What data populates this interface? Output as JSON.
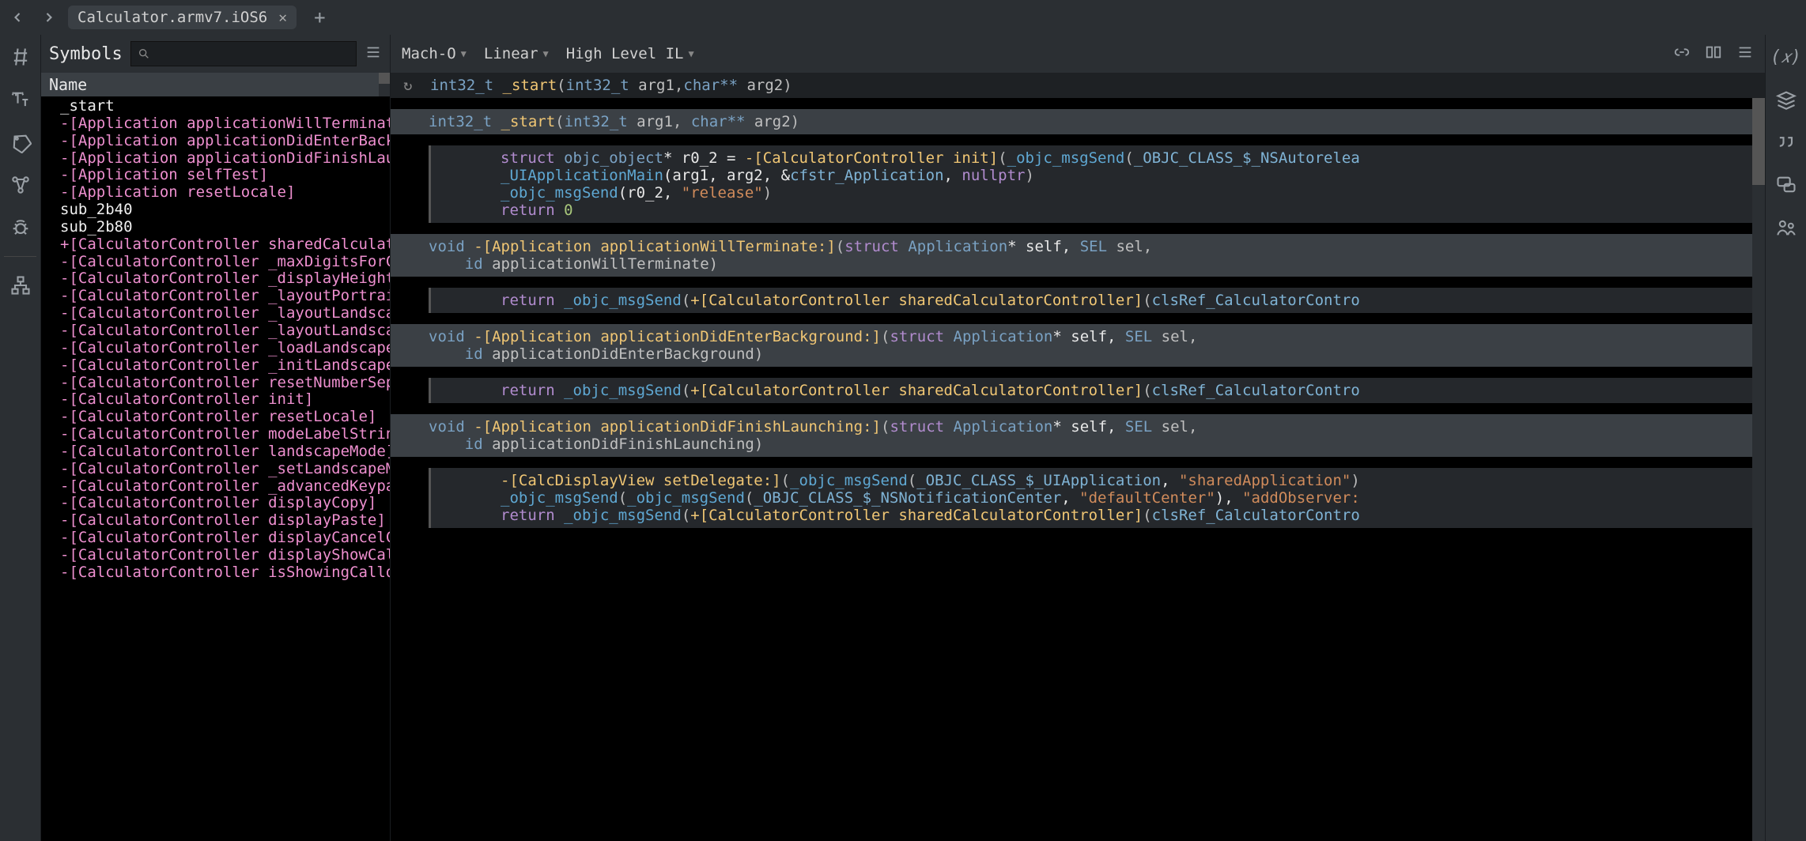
{
  "titlebar": {
    "tab_label": "Calculator.armv7.iOS6"
  },
  "sidebar": {
    "title": "Symbols",
    "column_header": "Name",
    "items": [
      {
        "text": "_start",
        "cls": "sym-white"
      },
      {
        "text": "-[Application applicationWillTerminate:]",
        "cls": "sym-pink"
      },
      {
        "text": "-[Application applicationDidEnterBackgrou",
        "cls": "sym-pink"
      },
      {
        "text": "-[Application applicationDidFinishLaunchi",
        "cls": "sym-pink"
      },
      {
        "text": "-[Application selfTest]",
        "cls": "sym-pink"
      },
      {
        "text": "-[Application resetLocale]",
        "cls": "sym-pink"
      },
      {
        "text": "sub_2b40",
        "cls": "sym-white"
      },
      {
        "text": "sub_2b80",
        "cls": "sym-white"
      },
      {
        "text": "+[CalculatorController sharedCalculatorCo",
        "cls": "sym-pink"
      },
      {
        "text": "-[CalculatorController _maxDigitsForCurre",
        "cls": "sym-pink"
      },
      {
        "text": "-[CalculatorController _displayHeightForC",
        "cls": "sym-pink"
      },
      {
        "text": "-[CalculatorController _layoutPortraitSub",
        "cls": "sym-pink"
      },
      {
        "text": "-[CalculatorController _layoutLandscapeSu",
        "cls": "sym-pink"
      },
      {
        "text": "-[CalculatorController _layoutLandscapeFo",
        "cls": "sym-pink"
      },
      {
        "text": "-[CalculatorController _loadLandscapeImag",
        "cls": "sym-pink"
      },
      {
        "text": "-[CalculatorController _initLandscape]",
        "cls": "sym-pink"
      },
      {
        "text": "-[CalculatorController resetNumberSeparat",
        "cls": "sym-pink"
      },
      {
        "text": "-[CalculatorController init]",
        "cls": "sym-pink"
      },
      {
        "text": "-[CalculatorController resetLocale]",
        "cls": "sym-pink"
      },
      {
        "text": "-[CalculatorController modeLabelString]",
        "cls": "sym-pink"
      },
      {
        "text": "-[CalculatorController landscapeMode]",
        "cls": "sym-pink"
      },
      {
        "text": "-[CalculatorController _setLandscapeMode:",
        "cls": "sym-pink"
      },
      {
        "text": "-[CalculatorController _advancedKeypadVie",
        "cls": "sym-pink"
      },
      {
        "text": "-[CalculatorController displayCopy]",
        "cls": "sym-pink"
      },
      {
        "text": "-[CalculatorController displayPaste]",
        "cls": "sym-pink"
      },
      {
        "text": "-[CalculatorController displayCancelCallo",
        "cls": "sym-pink"
      },
      {
        "text": "-[CalculatorController displayShowCallout",
        "cls": "sym-pink"
      },
      {
        "text": "-[CalculatorController isShowingCalloutBa",
        "cls": "sym-pink"
      }
    ]
  },
  "viewbar": {
    "format": "Mach-O",
    "mode": "Linear",
    "il": "High Level IL"
  },
  "signature": {
    "ret": "int32_t",
    "name": "_start",
    "p1t": "int32_t",
    "p1n": "arg1",
    "p2t": "char**",
    "p2n": "arg2"
  },
  "fn1": {
    "hdr_ret": "int32_t",
    "hdr_name": "_start",
    "hdr_p1t": "int32_t",
    "hdr_p1": "arg1",
    "hdr_p2t": "char**",
    "hdr_p2": "arg2",
    "l1a": "struct",
    "l1b": "objc_object",
    "l1c": "* r0_2 = ",
    "l1d": "-[CalculatorController init]",
    "l1e": "(",
    "l1f": "_objc_msgSend",
    "l1g": "(",
    "l1h": "_OBJC_CLASS_$_NSAutorelea",
    "l2a": "_UIApplicationMain",
    "l2b": "(arg1, arg2, &",
    "l2c": "cfstr_Application",
    "l2d": ", ",
    "l2e": "nullptr",
    "l2f": ")",
    "l3a": "_objc_msgSend",
    "l3b": "(r0_2, ",
    "l3c": "\"release\"",
    "l3d": ")",
    "l4a": "return",
    "l4b": "0"
  },
  "fn2": {
    "hdr_ret": "void",
    "hdr_name": "-[Application applicationWillTerminate:]",
    "hdr_p1t": "struct",
    "hdr_p1t2": "Application",
    "hdr_p1": "* self, ",
    "hdr_p2t": "SEL",
    "hdr_p2": "sel,",
    "hdr2_t": "id",
    "hdr2_n": "applicationWillTerminate)",
    "b1a": "return",
    "b1b": "_objc_msgSend",
    "b1c": "(",
    "b1d": "+[CalculatorController sharedCalculatorController]",
    "b1e": "(",
    "b1f": "clsRef_CalculatorContro"
  },
  "fn3": {
    "hdr_ret": "void",
    "hdr_name": "-[Application applicationDidEnterBackground:]",
    "hdr_p1t": "struct",
    "hdr_p1t2": "Application",
    "hdr_p1": "* self, ",
    "hdr_p2t": "SEL",
    "hdr_p2": "sel,",
    "hdr2_t": "id",
    "hdr2_n": "applicationDidEnterBackground)",
    "b1a": "return",
    "b1b": "_objc_msgSend",
    "b1c": "(",
    "b1d": "+[CalculatorController sharedCalculatorController]",
    "b1e": "(",
    "b1f": "clsRef_CalculatorContro"
  },
  "fn4": {
    "hdr_ret": "void",
    "hdr_name": "-[Application applicationDidFinishLaunching:]",
    "hdr_p1t": "struct",
    "hdr_p1t2": "Application",
    "hdr_p1": "* self, ",
    "hdr_p2t": "SEL",
    "hdr_p2": "sel,",
    "hdr2_t": "id",
    "hdr2_n": "applicationDidFinishLaunching)",
    "b1a": "-[CalcDisplayView setDelegate:]",
    "b1b": "(",
    "b1c": "_objc_msgSend",
    "b1d": "(",
    "b1e": "_OBJC_CLASS_$_UIApplication",
    "b1f": ", ",
    "b1g": "\"sharedApplication\"",
    "b1h": ")",
    "b2a": "_objc_msgSend",
    "b2b": "(",
    "b2c": "_objc_msgSend",
    "b2d": "(",
    "b2e": "_OBJC_CLASS_$_NSNotificationCenter",
    "b2f": ", ",
    "b2g": "\"defaultCenter\"",
    "b2h": "), ",
    "b2i": "\"addObserver:",
    "b3a": "return",
    "b3b": "_objc_msgSend",
    "b3c": "(",
    "b3d": "+[CalculatorController sharedCalculatorController]",
    "b3e": "(",
    "b3f": "clsRef_CalculatorContro"
  }
}
